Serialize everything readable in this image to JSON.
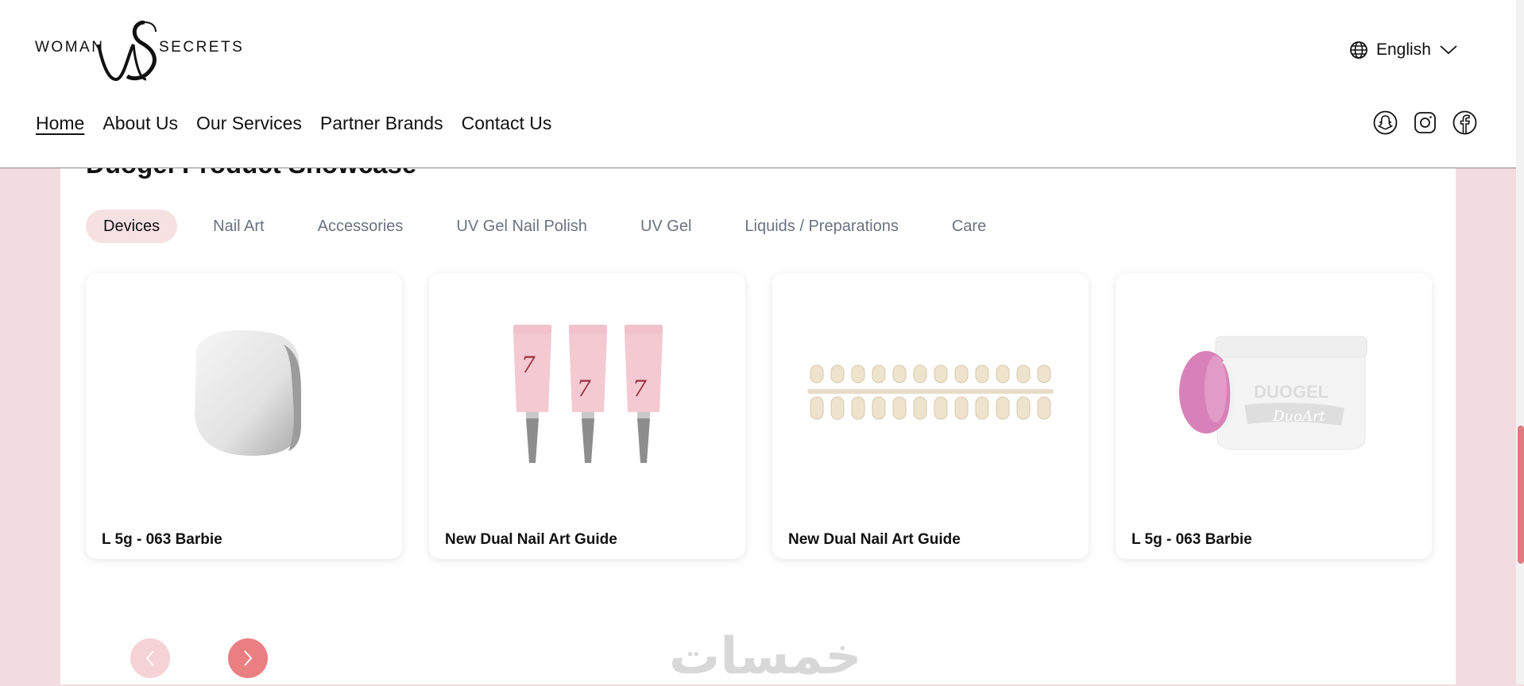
{
  "brand": {
    "logo_left": "WOMAN",
    "logo_right": "SECRETS",
    "logo_mark": "WS"
  },
  "language": {
    "label": "English",
    "icon": "globe-icon"
  },
  "nav": {
    "items": [
      {
        "label": "Home",
        "active": true
      },
      {
        "label": "About Us",
        "active": false
      },
      {
        "label": "Our Services",
        "active": false
      },
      {
        "label": "Partner Brands",
        "active": false
      },
      {
        "label": "Contact Us",
        "active": false
      }
    ]
  },
  "socials": [
    "snapchat-icon",
    "instagram-icon",
    "facebook-icon"
  ],
  "section": {
    "title": "Duogel Product Showcase"
  },
  "tabs": [
    {
      "label": "Devices",
      "active": true
    },
    {
      "label": "Nail Art",
      "active": false
    },
    {
      "label": "Accessories",
      "active": false
    },
    {
      "label": "UV Gel Nail Polish",
      "active": false
    },
    {
      "label": "UV Gel",
      "active": false
    },
    {
      "label": "Liquids / Preparations",
      "active": false
    },
    {
      "label": "Care",
      "active": false
    }
  ],
  "products": [
    {
      "title": "L 5g - 063 Barbie",
      "image": "white-nail-lamp"
    },
    {
      "title": "New Dual Nail Art Guide",
      "image": "pink-gel-tubes"
    },
    {
      "title": "New Dual Nail Art Guide",
      "image": "nail-tip-swatch-stick"
    },
    {
      "title": "L 5g - 063 Barbie",
      "image": "duogel-jar-with-pink-nail"
    }
  ],
  "jar_label": {
    "brand": "DUOGEL",
    "line": "DuoArt"
  },
  "watermark": "خمسات",
  "colors": {
    "page_background": "#f3dcdf",
    "active_tab": "#f6e0e2",
    "arrow_next": "#ea7e81",
    "arrow_prev": "#f5d2d5",
    "tab_text": "#6b7280"
  }
}
